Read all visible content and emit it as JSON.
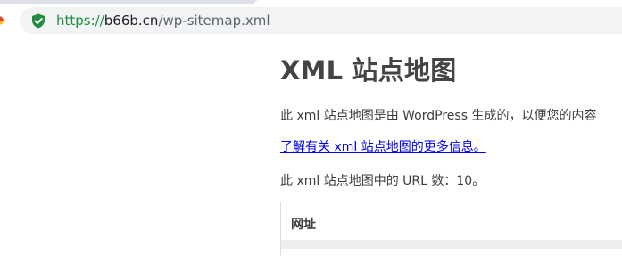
{
  "browser": {
    "url_scheme": "https://",
    "url_host": "b66b.cn",
    "url_path": "/wp-sitemap.xml",
    "secure_color": "#1e8e3e"
  },
  "page": {
    "title": "XML 站点地图",
    "description": "此 xml 站点地图是由 WordPress 生成的，以便您的内容",
    "learn_more_link": "了解有关 xml 站点地图的更多信息。",
    "url_count_text": "此 xml 站点地图中的 URL 数：10。",
    "table": {
      "column_header": "网址"
    }
  }
}
